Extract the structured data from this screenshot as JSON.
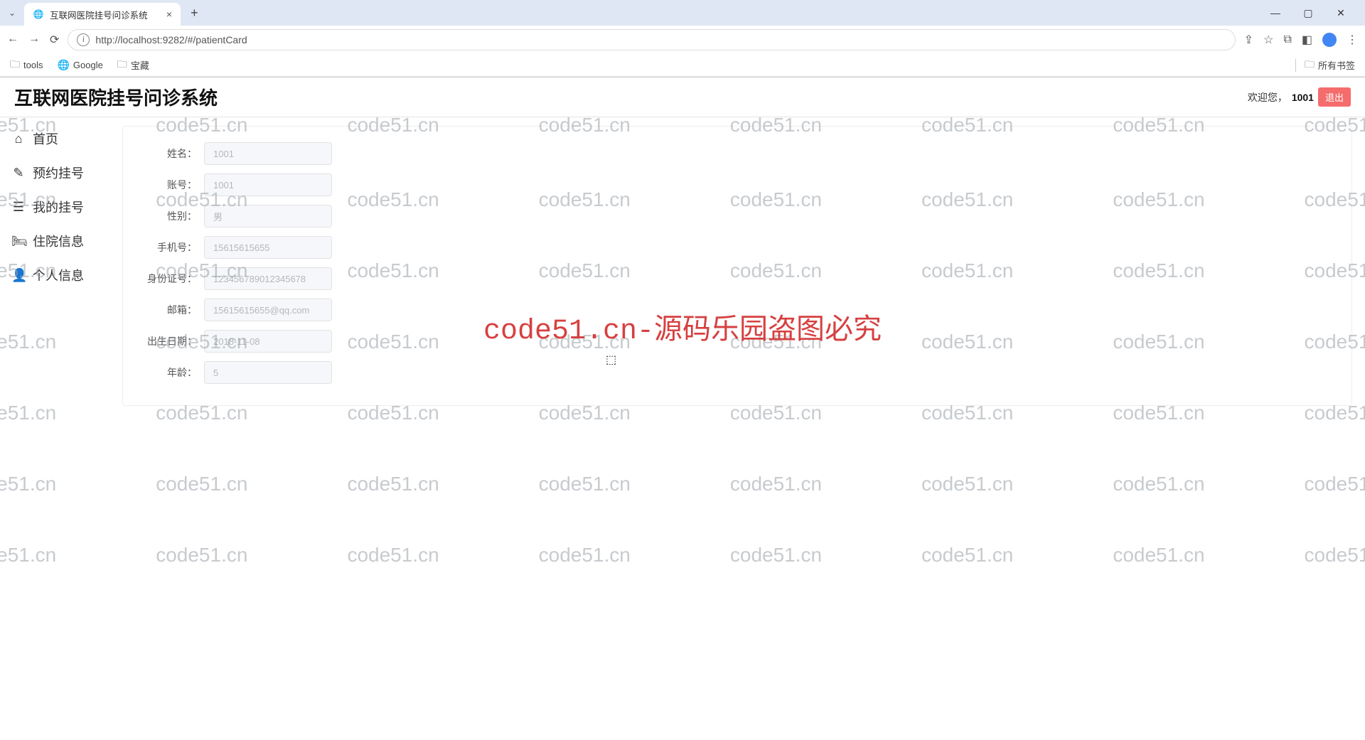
{
  "browser": {
    "tab_title": "互联网医院挂号问诊系统",
    "url": "http://localhost:9282/#/patientCard",
    "bookmarks": {
      "items": [
        {
          "label": "tools",
          "icon": "🗀"
        },
        {
          "label": "Google",
          "icon": "🌐"
        },
        {
          "label": "宝藏",
          "icon": "🗀"
        }
      ],
      "all_label": "所有书签"
    }
  },
  "header": {
    "app_title": "互联网医院挂号问诊系统",
    "welcome_prefix": "欢迎您，",
    "username": "1001",
    "logout_label": "退出"
  },
  "sidebar": {
    "items": [
      {
        "label": "首页",
        "icon": "⌂"
      },
      {
        "label": "预约挂号",
        "icon": "✎"
      },
      {
        "label": "我的挂号",
        "icon": "☰"
      },
      {
        "label": "住院信息",
        "icon": "🛏"
      },
      {
        "label": "个人信息",
        "icon": "👤"
      }
    ]
  },
  "form": {
    "fields": [
      {
        "label": "姓名：",
        "value": "1001"
      },
      {
        "label": "账号：",
        "value": "1001"
      },
      {
        "label": "性别：",
        "value": "男"
      },
      {
        "label": "手机号：",
        "value": "15615615655"
      },
      {
        "label": "身份证号：",
        "value": "123456789012345678"
      },
      {
        "label": "邮箱：",
        "value": "15615615655@qq.com"
      },
      {
        "label": "出生日期：",
        "value": "2018-11-08"
      },
      {
        "label": "年龄：",
        "value": "5"
      }
    ]
  },
  "watermark": {
    "text": "code51.cn",
    "center_text": "code51.cn-源码乐园盗图必究"
  }
}
